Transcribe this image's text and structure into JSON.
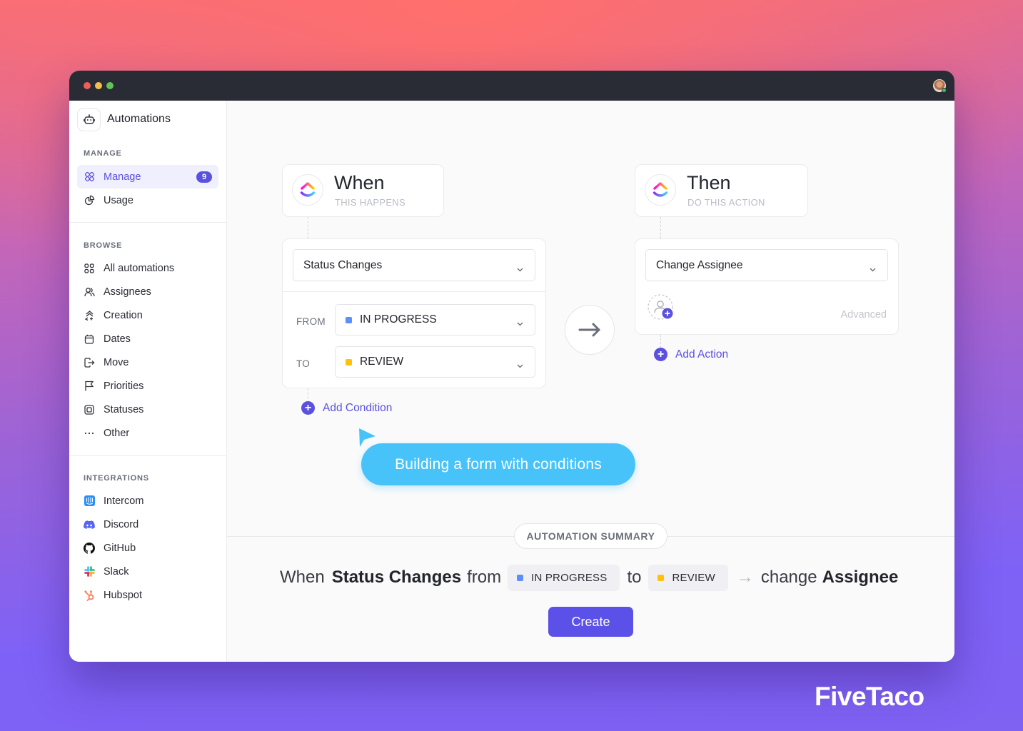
{
  "window": {
    "traffic_lights": [
      "close",
      "minimize",
      "maximize"
    ],
    "user_avatar": "user-avatar",
    "user_status": "online"
  },
  "sidebar": {
    "title": "Automations",
    "title_icon": "robot-icon",
    "sections": [
      {
        "label": "MANAGE",
        "items": [
          {
            "label": "Manage",
            "icon": "manage-icon",
            "active": true,
            "badge": "9"
          },
          {
            "label": "Usage",
            "icon": "pie-chart-icon"
          }
        ]
      },
      {
        "label": "BROWSE",
        "items": [
          {
            "label": "All automations",
            "icon": "grid-icon"
          },
          {
            "label": "Assignees",
            "icon": "users-icon"
          },
          {
            "label": "Creation",
            "icon": "creation-icon"
          },
          {
            "label": "Dates",
            "icon": "calendar-icon"
          },
          {
            "label": "Move",
            "icon": "move-icon"
          },
          {
            "label": "Priorities",
            "icon": "flag-icon"
          },
          {
            "label": "Statuses",
            "icon": "status-icon"
          },
          {
            "label": "Other",
            "icon": "ellipsis-icon"
          }
        ]
      },
      {
        "label": "INTEGRATIONS",
        "items": [
          {
            "label": "Intercom",
            "icon": "intercom-icon"
          },
          {
            "label": "Discord",
            "icon": "discord-icon"
          },
          {
            "label": "GitHub",
            "icon": "github-icon"
          },
          {
            "label": "Slack",
            "icon": "slack-icon"
          },
          {
            "label": "Hubspot",
            "icon": "hubspot-icon"
          }
        ]
      }
    ]
  },
  "trigger": {
    "title": "When",
    "subtitle": "THIS HAPPENS",
    "event": "Status Changes",
    "from_label": "FROM",
    "from_value": "IN PROGRESS",
    "from_color": "#5b8ff9",
    "to_label": "TO",
    "to_value": "REVIEW",
    "to_color": "#ffc20a",
    "add_condition": "Add Condition"
  },
  "action": {
    "title": "Then",
    "subtitle": "DO THIS ACTION",
    "event": "Change Assignee",
    "advanced": "Advanced",
    "add_action": "Add Action"
  },
  "tooltip": {
    "text": "Building a form with conditions"
  },
  "summary": {
    "label": "AUTOMATION SUMMARY",
    "when": "When",
    "event": "Status Changes",
    "from": "from",
    "from_status": "IN PROGRESS",
    "to": "to",
    "to_status": "REVIEW",
    "change": "change",
    "target": "Assignee",
    "create_button": "Create"
  },
  "brand": {
    "name": "FiveTaco"
  },
  "colors": {
    "accent": "#5b51e0",
    "tooltip": "#47c3fa",
    "in_progress": "#5b8ff9",
    "review": "#ffc20a"
  }
}
